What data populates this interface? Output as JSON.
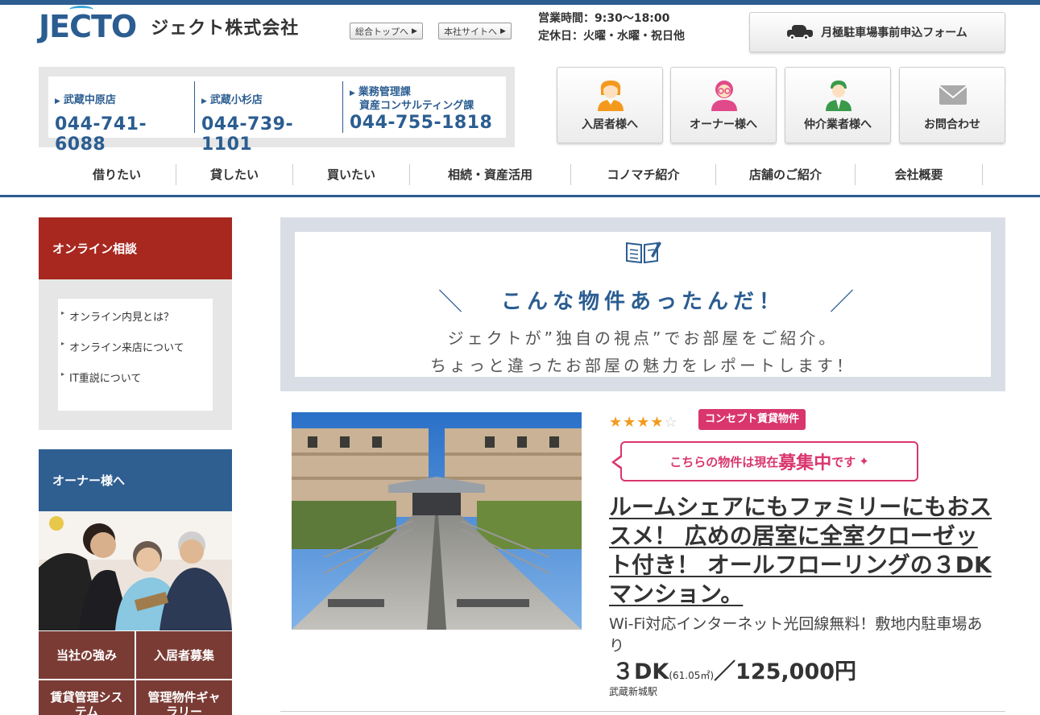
{
  "header": {
    "logo_en": "JECTO",
    "logo_ja": "ジェクト株式会社",
    "links": [
      "総合トップへ",
      "本社サイトへ"
    ],
    "hours_line1": "営業時間：9:30〜18:00",
    "hours_line2": "定休日：火曜・水曜・祝日他",
    "parking_label": "月極駐車場事前申込フォーム"
  },
  "phones": [
    {
      "label": "武蔵中原店",
      "label2": "",
      "number": "044-741-6088"
    },
    {
      "label": "武蔵小杉店",
      "label2": "",
      "number": "044-739-1101"
    },
    {
      "label": "業務管理課",
      "label2": "資産コンサルティング課",
      "number": "044-755-1818"
    }
  ],
  "icon_buttons": [
    {
      "label": "入居者様へ",
      "icon": "resident-icon",
      "color": "#f39a1e"
    },
    {
      "label": "オーナー様へ",
      "icon": "owner-icon",
      "color": "#e04a8a"
    },
    {
      "label": "仲介業者様へ",
      "icon": "agent-icon",
      "color": "#3a9a4a"
    },
    {
      "label": "お問合わせ",
      "icon": "mail-icon",
      "color": "#aaaaaa"
    }
  ],
  "nav": [
    "借りたい",
    "貸したい",
    "買いたい",
    "相続・資産活用",
    "コノマチ紹介",
    "店舗のご紹介",
    "会社概要"
  ],
  "sidebar": {
    "online_title": "オンライン相談",
    "online_items": [
      "オンライン内見とは？",
      "オンライン来店について",
      "IT重説について"
    ],
    "owner_title": "オーナー様へ",
    "owner_buttons": [
      "当社の強み",
      "入居者募集",
      "賃貸管理システム",
      "管理物件ギャラリー"
    ]
  },
  "banner": {
    "title": "こんな物件あったんだ！",
    "sub1": "ジェクトが”独自の視点”でお部屋をご紹介。",
    "sub2": "ちょっと違ったお部屋の魅力をレポートします！"
  },
  "property": {
    "rating": 4,
    "rating_max": 5,
    "badge": "コンセプト賃貸物件",
    "recruit_pre": "こちらの物件は現在",
    "recruit_big": "募集中",
    "recruit_post": "です",
    "title": "ルームシェアにもファミリーにもおススメ！ 広めの居室に全室クローゼット付き！ オールフローリングの３DKマンション。",
    "desc": "Wi-Fi対応インターネット光回線無料！敷地内駐車場あり",
    "layout": "３DK",
    "area": "(61.05㎡)",
    "price": "／125,000円",
    "station": "武蔵新城駅"
  },
  "colors": {
    "brand": "#2b5d91",
    "red": "#a8281f",
    "pink": "#d9366e",
    "star": "#f39a1e"
  }
}
